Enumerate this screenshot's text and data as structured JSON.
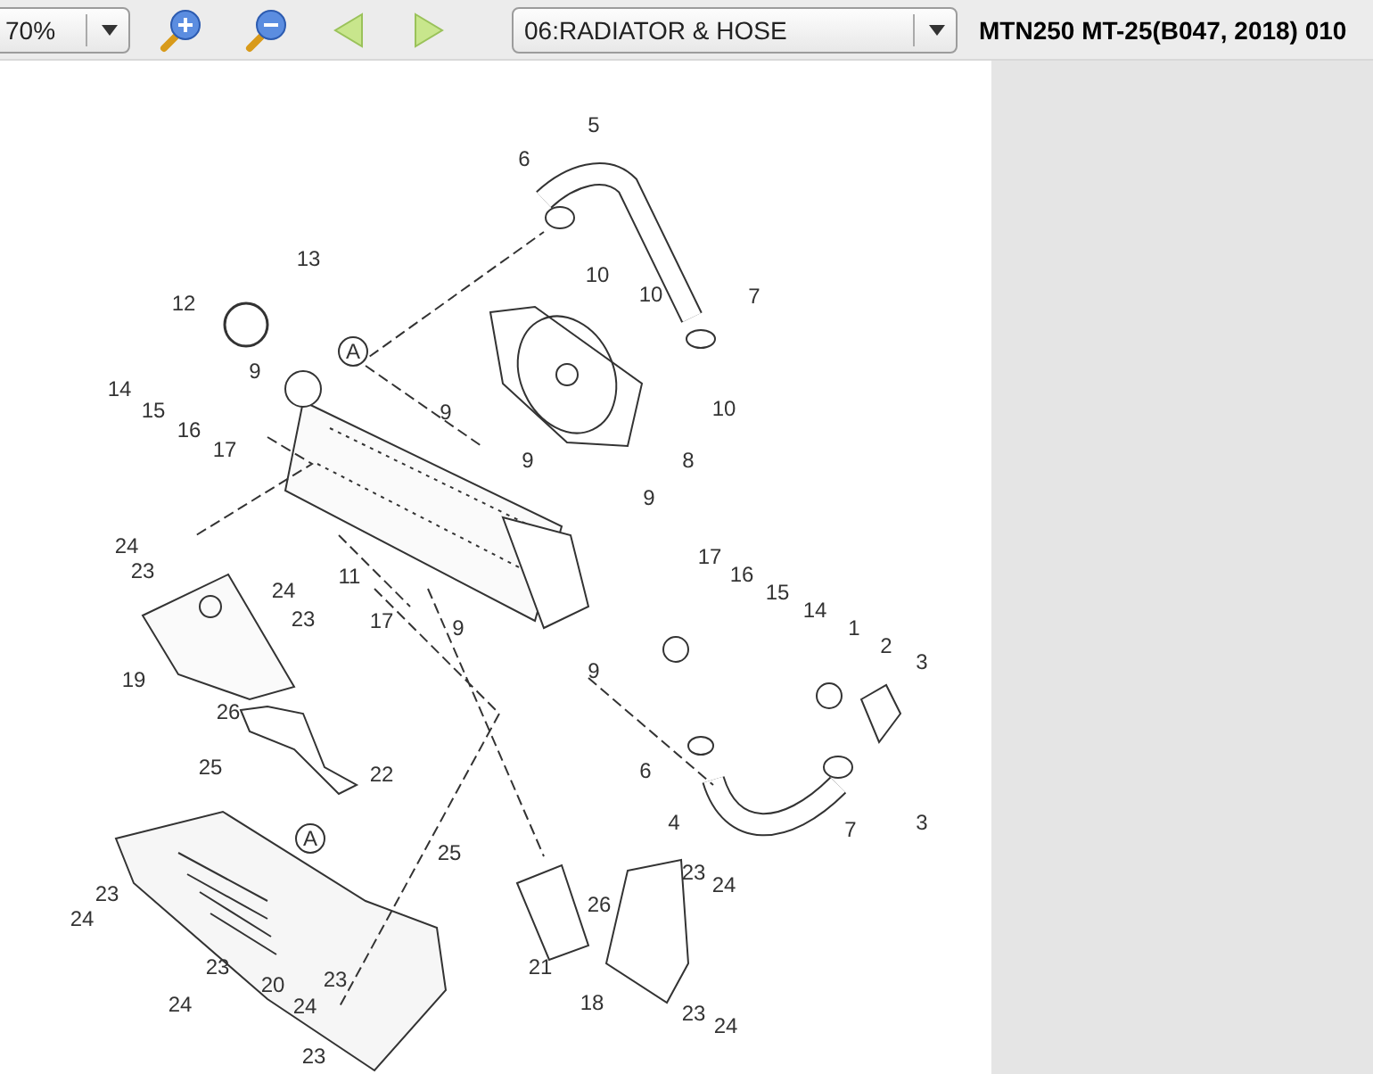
{
  "toolbar": {
    "zoom": "70%",
    "section": "06:RADIATOR & HOSE",
    "model_title": "MTN250 MT-25(B047, 2018) 010"
  },
  "diagram": {
    "reference_marks": [
      "A",
      "A"
    ],
    "callouts": [
      "5",
      "6",
      "13",
      "12",
      "10",
      "10",
      "7",
      "14",
      "15",
      "16",
      "9",
      "17",
      "9",
      "9",
      "10",
      "8",
      "9",
      "24",
      "23",
      "11",
      "24",
      "23",
      "17",
      "9",
      "17",
      "16",
      "15",
      "14",
      "1",
      "2",
      "3",
      "9",
      "19",
      "26",
      "25",
      "22",
      "6",
      "4",
      "7",
      "3",
      "25",
      "23",
      "24",
      "23",
      "24",
      "20",
      "23",
      "24",
      "23",
      "23",
      "24",
      "26",
      "21",
      "18",
      "23",
      "24"
    ]
  }
}
